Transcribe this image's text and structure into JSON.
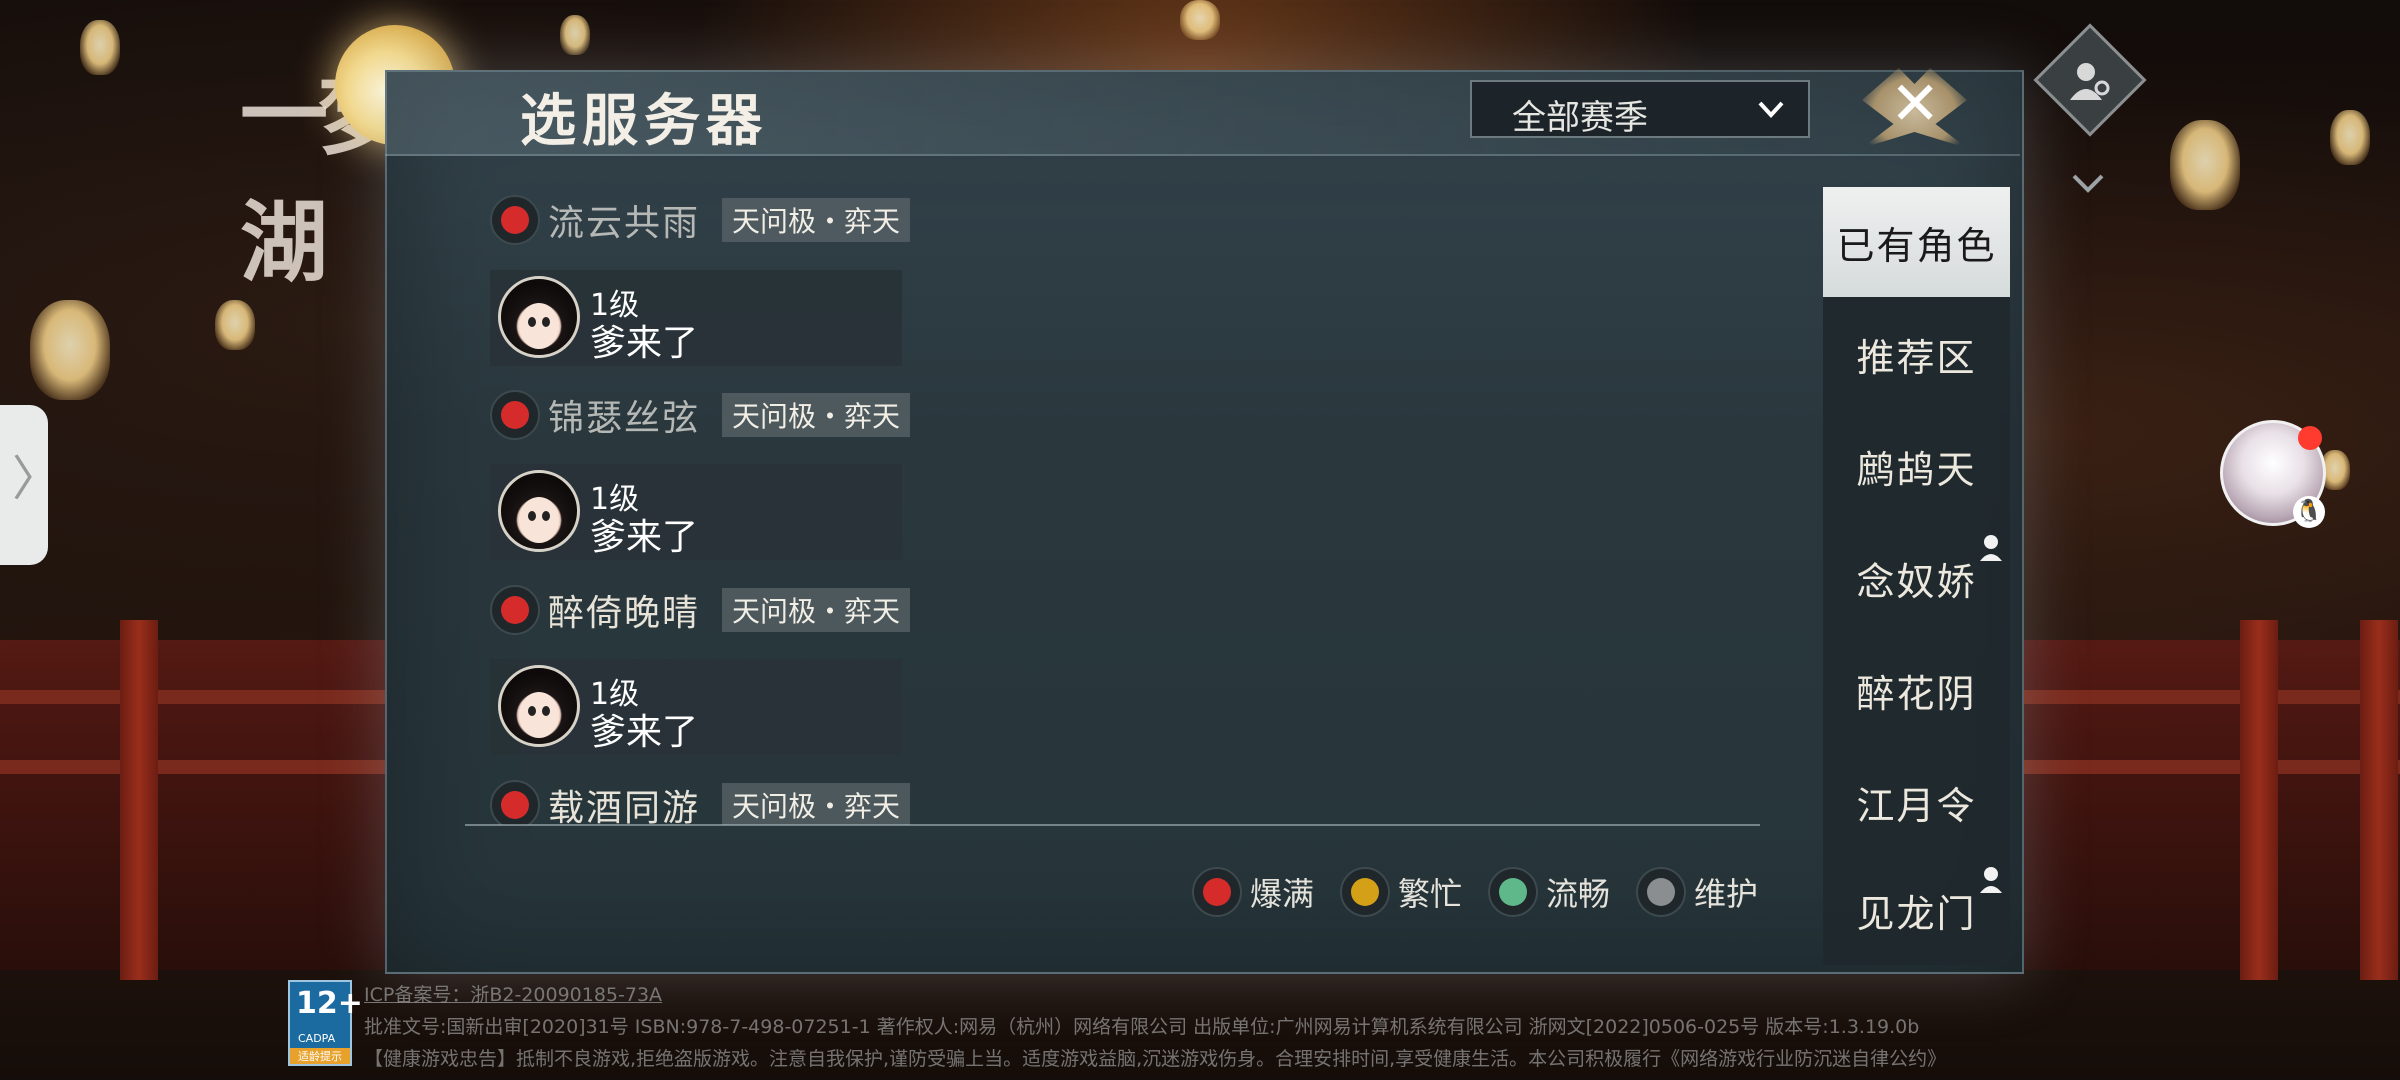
{
  "logo": {
    "text": "一梦江湖"
  },
  "dialog": {
    "title": "选服务器"
  },
  "season_filter": {
    "selected": "全部赛季"
  },
  "servers": [
    {
      "name": "流云共雨",
      "tag": "天问极・弈天",
      "status": "爆满",
      "status_color": "#d62b2b",
      "character": {
        "level": "1级",
        "name": "爹来了"
      }
    },
    {
      "name": "锦瑟丝弦",
      "tag": "天问极・弈天",
      "status": "爆满",
      "status_color": "#d62b2b",
      "character": {
        "level": "1级",
        "name": "爹来了"
      }
    },
    {
      "name": "醉倚晚晴",
      "tag": "天问极・弈天",
      "status": "爆满",
      "status_color": "#d62b2b",
      "character": {
        "level": "1级",
        "name": "爹来了"
      }
    },
    {
      "name": "载酒同游",
      "tag": "天问极・弈天",
      "status": "爆满",
      "status_color": "#d62b2b"
    }
  ],
  "legend": [
    {
      "label": "爆满",
      "color": "#d62b2b"
    },
    {
      "label": "繁忙",
      "color": "#d4a017"
    },
    {
      "label": "流畅",
      "color": "#5fb88a"
    },
    {
      "label": "维护",
      "color": "#8a8e90"
    }
  ],
  "tabs": [
    {
      "label": "已有角色",
      "active": true
    },
    {
      "label": "推荐区"
    },
    {
      "label": "鹧鸪天"
    },
    {
      "label": "念奴娇",
      "badge": "person-icon"
    },
    {
      "label": "醉花阴"
    },
    {
      "label": "江月令"
    },
    {
      "label": "见龙门",
      "badge": "person-icon"
    }
  ],
  "footer": {
    "age_rating": "12+",
    "age_org": "CADPA",
    "age_tip": "适龄提示",
    "icp": "ICP备案号：浙B2-20090185-73A",
    "approval": "批准文号:国新出审[2020]31号 ISBN:978-7-498-07251-1 著作权人:网易（杭州）网络有限公司 出版单位:广州网易计算机系统有限公司 浙网文[2022]0506-025号 版本号:1.3.19.0b",
    "health": "【健康游戏忠告】抵制不良游戏,拒绝盗版游戏。注意自我保护,谨防受骗上当。适度游戏益脑,沉迷游戏伤身。合理安排时间,享受健康生活。本公司积极履行《网络游戏行业防沉迷自律公约》"
  },
  "drawer": {
    "arrow": "〉"
  },
  "close": {
    "glyph": "✕"
  }
}
